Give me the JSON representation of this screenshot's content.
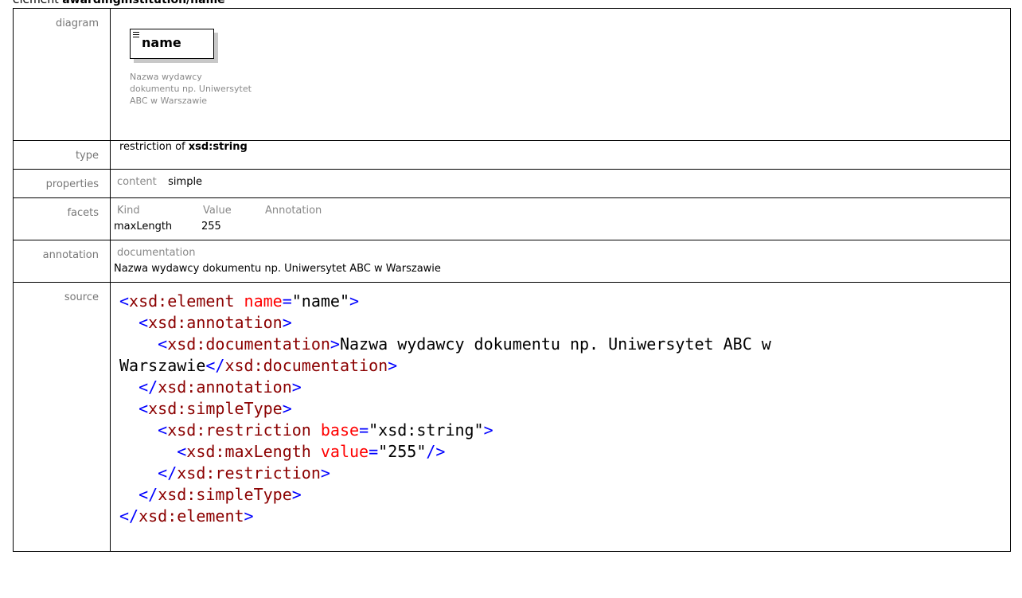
{
  "title": {
    "prefix": "element",
    "name": "awardinginstitution/name"
  },
  "rows": {
    "diagram_label": "diagram",
    "type_label": "type",
    "properties_label": "properties",
    "facets_label": "facets",
    "annotation_label": "annotation",
    "source_label": "source"
  },
  "diagram": {
    "element_name": "name",
    "documentation_lines": [
      "Nazwa wydawcy",
      "dokumentu np. Uniwersytet",
      "ABC w Warszawie"
    ]
  },
  "type": {
    "prefix": "restriction of",
    "base": "xsd:string"
  },
  "properties": {
    "key": "content",
    "value": "simple"
  },
  "facets": {
    "headers": [
      "Kind",
      "Value",
      "Annotation"
    ],
    "rows": [
      {
        "kind": "maxLength",
        "value": "255"
      }
    ]
  },
  "annotation": {
    "header": "documentation",
    "text": "Nazwa wydawcy dokumentu np. Uniwersytet ABC w Warszawie"
  },
  "source": {
    "lines": [
      "<xsd:element name=\"name\">",
      "  <xsd:annotation>",
      "    <xsd:documentation>Nazwa wydawcy dokumentu np. Uniwersytet ABC w",
      "Warszawie</xsd:documentation>",
      "  </xsd:annotation>",
      "  <xsd:simpleType>",
      "    <xsd:restriction base=\"xsd:string\">",
      "      <xsd:maxLength value=\"255\"/>",
      "    </xsd:restriction>",
      "  </xsd:simpleType>",
      "</xsd:element>"
    ]
  },
  "colors": {
    "tag_bracket": "#0000ff",
    "tag_name": "#8b0000",
    "attr_name": "#ff0000",
    "label_gray": "#777777"
  }
}
